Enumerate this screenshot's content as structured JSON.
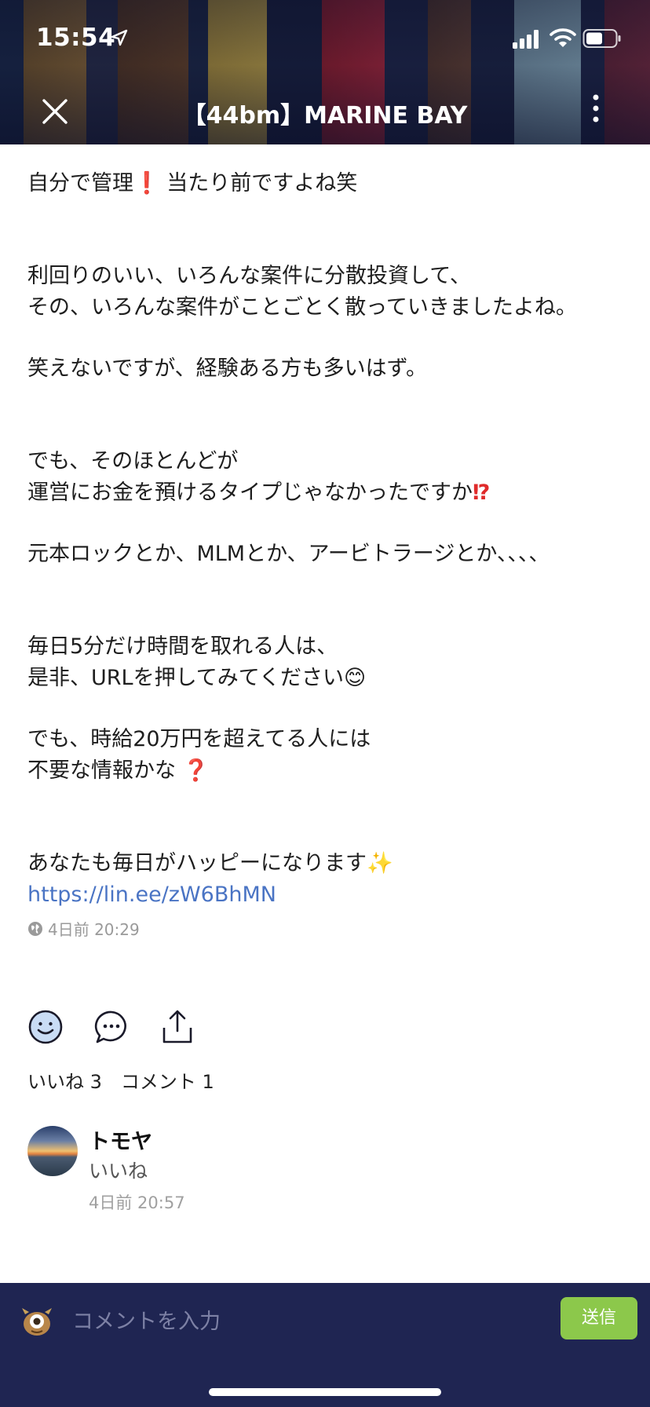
{
  "status": {
    "time": "15:54",
    "icons": [
      "location-arrow-icon",
      "signal-icon",
      "wifi-icon",
      "battery-icon"
    ]
  },
  "header": {
    "title": "【44bm】MARINE BAY",
    "close_icon": "close-icon",
    "more_icon": "more-vertical-icon"
  },
  "post": {
    "line1": "自分で管理",
    "line1_emoji": "❗",
    "line1_b": "当たり前ですよね笑",
    "line2": "利回りのいい、いろんな案件に分散投資して、",
    "line3": "その、いろんな案件がことごとく散っていきましたよね。",
    "line4": "笑えないですが、経験ある方も多いはず。",
    "line5": "でも、そのほとんどが",
    "line6": "運営にお金を預けるタイプじゃなかったですか",
    "line6_emoji": "⁉",
    "line7": "元本ロックとか、MLMとか、アービトラージとか、、、、",
    "line8": "毎日5分だけ時間を取れる人は、",
    "line9": "是非、URLを押してみてください",
    "line9_emoji": "😊",
    "line10": "でも、時給20万円を超えてる人には",
    "line11": "不要な情報かな",
    "line11_emoji": "❓",
    "line12": "あなたも毎日がハッピーになります",
    "line12_emoji": "✨",
    "link": "https://lin.ee/zW6BhMN",
    "timestamp": "4日前 20:29"
  },
  "actions": {
    "like_icon": "smiley-icon",
    "comment_icon": "speech-bubble-icon",
    "share_icon": "share-icon",
    "likes_label": "いいね 3",
    "comments_label": "コメント 1"
  },
  "comment": {
    "name": "トモヤ",
    "text": "いいね",
    "time": "4日前 20:57"
  },
  "composer": {
    "placeholder": "コメントを入力",
    "send_label": "送信"
  },
  "colors": {
    "link": "#4a74c4",
    "bottom_bar": "#1f2552",
    "send_button": "#8cc84b"
  }
}
